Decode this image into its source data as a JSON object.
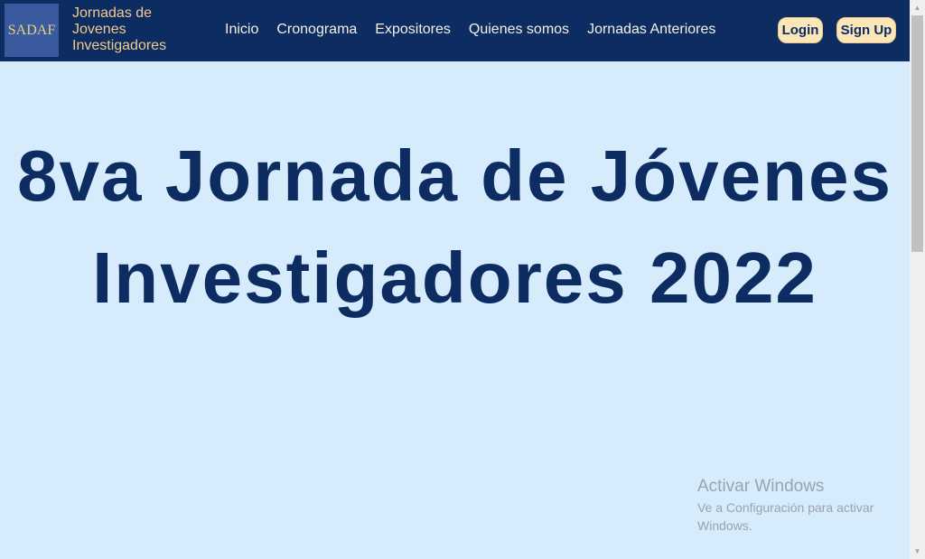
{
  "navbar": {
    "logo_text": "SADAF",
    "site_title": "Jornadas de Jovenes Investigadores",
    "links": [
      "Inicio",
      "Cronograma",
      "Expositores",
      "Quienes somos",
      "Jornadas Anteriores"
    ],
    "login_label": "Login",
    "signup_label": "Sign Up"
  },
  "hero": {
    "title": "8va Jornada de Jóvenes Investigadores 2022"
  },
  "watermark": {
    "title": "Activar Windows",
    "subtitle": "Ve a Configuración para activar Windows."
  },
  "scrollbar": {
    "up_icon": "▲",
    "down_icon": "▼"
  },
  "colors": {
    "navbar_bg": "#0d2d62",
    "hero_bg": "#d6ebfc",
    "title_color": "#0d2d62",
    "button_bg": "#fbe6b8",
    "site_title_color": "#f2c98a"
  }
}
